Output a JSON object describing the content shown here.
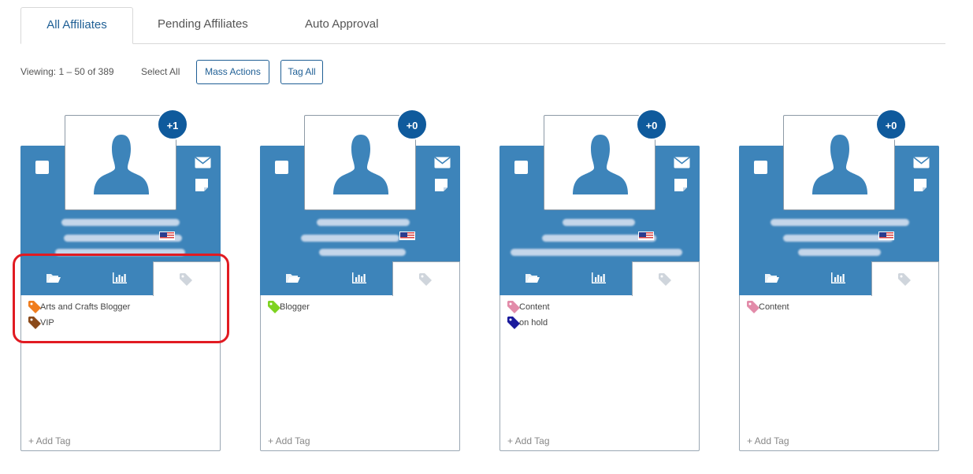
{
  "tabs": [
    {
      "label": "All Affiliates",
      "active": true
    },
    {
      "label": "Pending Affiliates",
      "active": false
    },
    {
      "label": "Auto Approval",
      "active": false
    }
  ],
  "toolbar": {
    "viewing": "Viewing: 1 – 50 of 389",
    "select_all": "Select All",
    "mass_actions": "Mass Actions",
    "tag_all": "Tag All"
  },
  "colors": {
    "header_blue": "#3d84ba",
    "badge_blue": "#0f5a9c",
    "accent": "#1f5f95",
    "highlight_red": "#e11b22"
  },
  "cards": [
    {
      "badge": "+1",
      "add_tag": "+ Add Tag",
      "tags": [
        {
          "label": "Arts and Crafts Blogger",
          "color": "#f07d1e"
        },
        {
          "label": "VIP",
          "color": "#8b4a1a"
        }
      ]
    },
    {
      "badge": "+0",
      "add_tag": "+ Add Tag",
      "tags": [
        {
          "label": "Blogger",
          "color": "#7ed321"
        }
      ]
    },
    {
      "badge": "+0",
      "add_tag": "+ Add Tag",
      "tags": [
        {
          "label": "Content",
          "color": "#e28ba9"
        },
        {
          "label": "on hold",
          "color": "#1a1a9c"
        }
      ]
    },
    {
      "badge": "+0",
      "add_tag": "+ Add Tag",
      "tags": [
        {
          "label": "Content",
          "color": "#e28ba9"
        }
      ]
    }
  ],
  "icons": {
    "card_actions": [
      "envelope-icon",
      "note-icon"
    ],
    "subtabs": [
      "folder-icon",
      "bar-chart-icon",
      "tag-icon"
    ]
  }
}
